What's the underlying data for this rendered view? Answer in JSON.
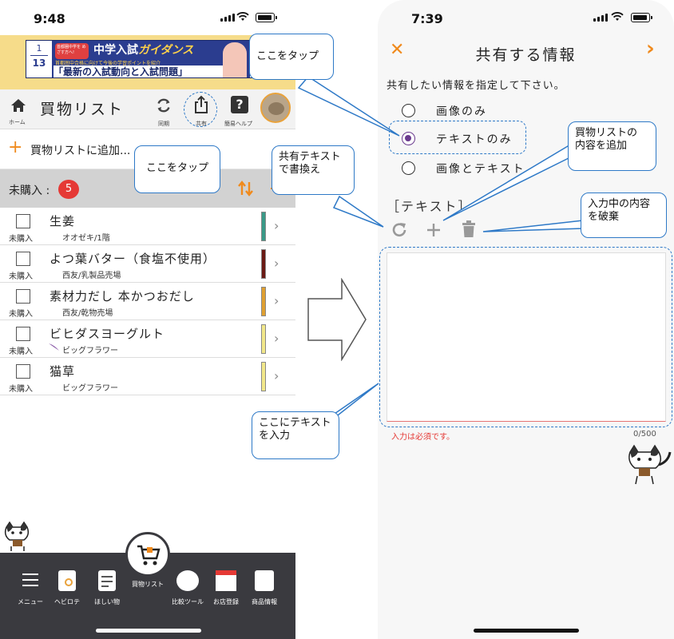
{
  "left": {
    "status": {
      "time": "9:48"
    },
    "ad": {
      "date_top": "1",
      "date_bottom": "13",
      "badge": "首都圏中学を めざす方へ!",
      "title": "中学入試",
      "title_accent": "ガイダンス",
      "desc": "首都圏中合格に向けて今後の学習ポイントを紹介",
      "headline": "「最新の入試動向と入試問題」"
    },
    "header": {
      "home_label": "ホーム",
      "title": "買物リスト",
      "sync_label": "同期",
      "share_label": "共有",
      "help_label": "簡易ヘルプ",
      "help_glyph": "?"
    },
    "add_row": {
      "plus": "+",
      "text": "買物リストに追加..."
    },
    "unpurchased": {
      "label": "未購入 :",
      "count": "5"
    },
    "items": [
      {
        "name": "生姜",
        "store": "オオゼキ/1階",
        "status": "未購入",
        "color": "#3a9a88"
      },
      {
        "name": "よつ葉バター（食塩不使用）",
        "store": "西友/乳製品売場",
        "status": "未購入",
        "color": "#6b1a14"
      },
      {
        "name": "素材力だし 本かつおだし",
        "store": "西友/乾物売場",
        "status": "未購入",
        "color": "#e0a030"
      },
      {
        "name": "ビヒダスヨーグルト",
        "store": "ビッグフラワー",
        "status": "未購入",
        "color": "#f2e88a"
      },
      {
        "name": "猫草",
        "store": "ビッグフラワー",
        "status": "未購入",
        "color": "#f2e88a"
      }
    ],
    "tabbar": {
      "menu": "メニュー",
      "hebirote": "ヘビロテ",
      "wishlist": "ほしい物",
      "shopping": "買物リスト",
      "compare": "比較ツール",
      "stores": "お店登録",
      "products": "商品情報"
    }
  },
  "right": {
    "status": {
      "time": "7:39"
    },
    "nav": {
      "close": "✕",
      "title": "共有する情報",
      "next": "›"
    },
    "instruction": "共有したい情報を指定して下さい。",
    "options": [
      {
        "label": "画像のみ",
        "selected": false
      },
      {
        "label": "テキストのみ",
        "selected": true
      },
      {
        "label": "画像とテキスト",
        "selected": false
      }
    ],
    "section": "［テキスト］",
    "textarea": {
      "error": "入力は必須です。",
      "counter": "0/500"
    }
  },
  "annotations": {
    "tap_top": "ここをタップ",
    "tap_share": "ここをタップ",
    "shared_text": "共有テキスト\nで書換え",
    "add_list": "買物リストの\n内容を追加",
    "discard": "入力中の内容\nを破棄",
    "enter_text": "ここにテキスト\nを入力"
  },
  "colors": {
    "accent_orange": "#f08a1c",
    "purple": "#6a3a8e",
    "badge_red": "#e53935",
    "callout_blue": "#2e79c7",
    "tabbar": "#3a3a3f"
  }
}
